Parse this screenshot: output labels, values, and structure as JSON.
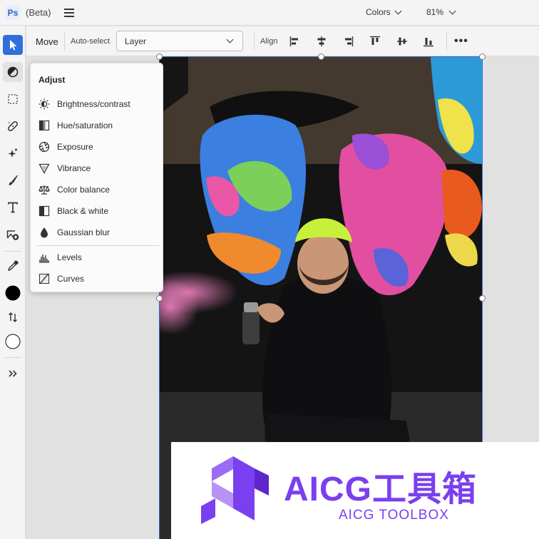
{
  "app": {
    "logo_text": "Ps",
    "beta_label": "(Beta)"
  },
  "header": {
    "colors_label": "Colors",
    "zoom_label": "81%"
  },
  "options_bar": {
    "move_label": "Move",
    "auto_select_label": "Auto-select",
    "layer_select_value": "Layer",
    "align_label": "Align",
    "more_label": "•••"
  },
  "adjust_panel": {
    "title": "Adjust",
    "items": [
      {
        "label": "Brightness/contrast",
        "icon": "brightness-icon"
      },
      {
        "label": "Hue/saturation",
        "icon": "hue-saturation-icon"
      },
      {
        "label": "Exposure",
        "icon": "exposure-icon"
      },
      {
        "label": "Vibrance",
        "icon": "vibrance-icon"
      },
      {
        "label": "Color balance",
        "icon": "color-balance-icon"
      },
      {
        "label": "Black & white",
        "icon": "black-white-icon"
      },
      {
        "label": "Gaussian blur",
        "icon": "gaussian-blur-icon"
      },
      {
        "label": "Levels",
        "icon": "levels-icon"
      },
      {
        "label": "Curves",
        "icon": "curves-icon"
      }
    ]
  },
  "tools": [
    "move-tool-icon",
    "adjustment-tool-icon",
    "marquee-tool-icon",
    "healing-tool-icon",
    "generative-fill-icon",
    "brush-tool-icon",
    "type-tool-icon",
    "add-image-icon",
    "eyedropper-icon",
    "foreground-color-swatch",
    "swap-colors-icon",
    "background-color-swatch",
    "expand-toolbar-icon"
  ],
  "colors": {
    "accent": "#2f6fdb",
    "foreground_swatch": "#000000",
    "background_swatch": "#ffffff",
    "watermark": "#7a3ff0"
  },
  "watermark": {
    "title": "AICG工具箱",
    "subtitle": "AICG TOOLBOX"
  }
}
